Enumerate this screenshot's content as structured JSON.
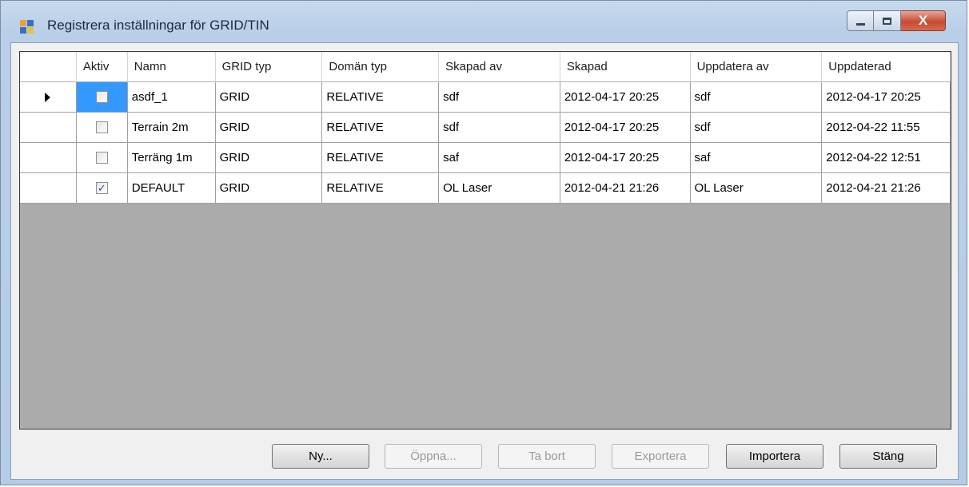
{
  "window": {
    "title": "Registrera inställningar för GRID/TIN",
    "caption_icons": {
      "minimize": "minimize-icon",
      "maximize": "maximize-icon",
      "close": "close-icon"
    },
    "close_glyph": "X"
  },
  "grid": {
    "columns": [
      "Aktiv",
      "Namn",
      "GRID typ",
      "Domän typ",
      "Skapad av",
      "Skapad",
      "Uppdatera av",
      "Uppdaterad"
    ],
    "rows": [
      {
        "current": true,
        "aktiv": false,
        "namn": "asdf_1",
        "grid_typ": "GRID",
        "doman_typ": "RELATIVE",
        "skapad_av": "sdf",
        "skapad": "2012-04-17 20:25",
        "uppdatera_av": "sdf",
        "uppdaterad": "2012-04-17 20:25"
      },
      {
        "current": false,
        "aktiv": false,
        "namn": "Terrain 2m",
        "grid_typ": "GRID",
        "doman_typ": "RELATIVE",
        "skapad_av": "sdf",
        "skapad": "2012-04-17 20:25",
        "uppdatera_av": "sdf",
        "uppdaterad": "2012-04-22 11:55"
      },
      {
        "current": false,
        "aktiv": false,
        "namn": "Terräng 1m",
        "grid_typ": "GRID",
        "doman_typ": "RELATIVE",
        "skapad_av": "saf",
        "skapad": "2012-04-17 20:25",
        "uppdatera_av": "saf",
        "uppdaterad": "2012-04-22 12:51"
      },
      {
        "current": false,
        "aktiv": true,
        "namn": "DEFAULT",
        "grid_typ": "GRID",
        "doman_typ": "RELATIVE",
        "skapad_av": "OL Laser",
        "skapad": "2012-04-21 21:26",
        "uppdatera_av": "OL Laser",
        "uppdaterad": "2012-04-21 21:26"
      }
    ]
  },
  "buttons": {
    "ny": "Ny...",
    "oppna": "Öppna...",
    "ta_bort": "Ta bort",
    "exportera": "Exportera",
    "importera": "Importera",
    "stang": "Stäng"
  },
  "colors": {
    "selection": "#3399ff",
    "grid_background": "#ababab",
    "close_button": "#c74a30"
  }
}
